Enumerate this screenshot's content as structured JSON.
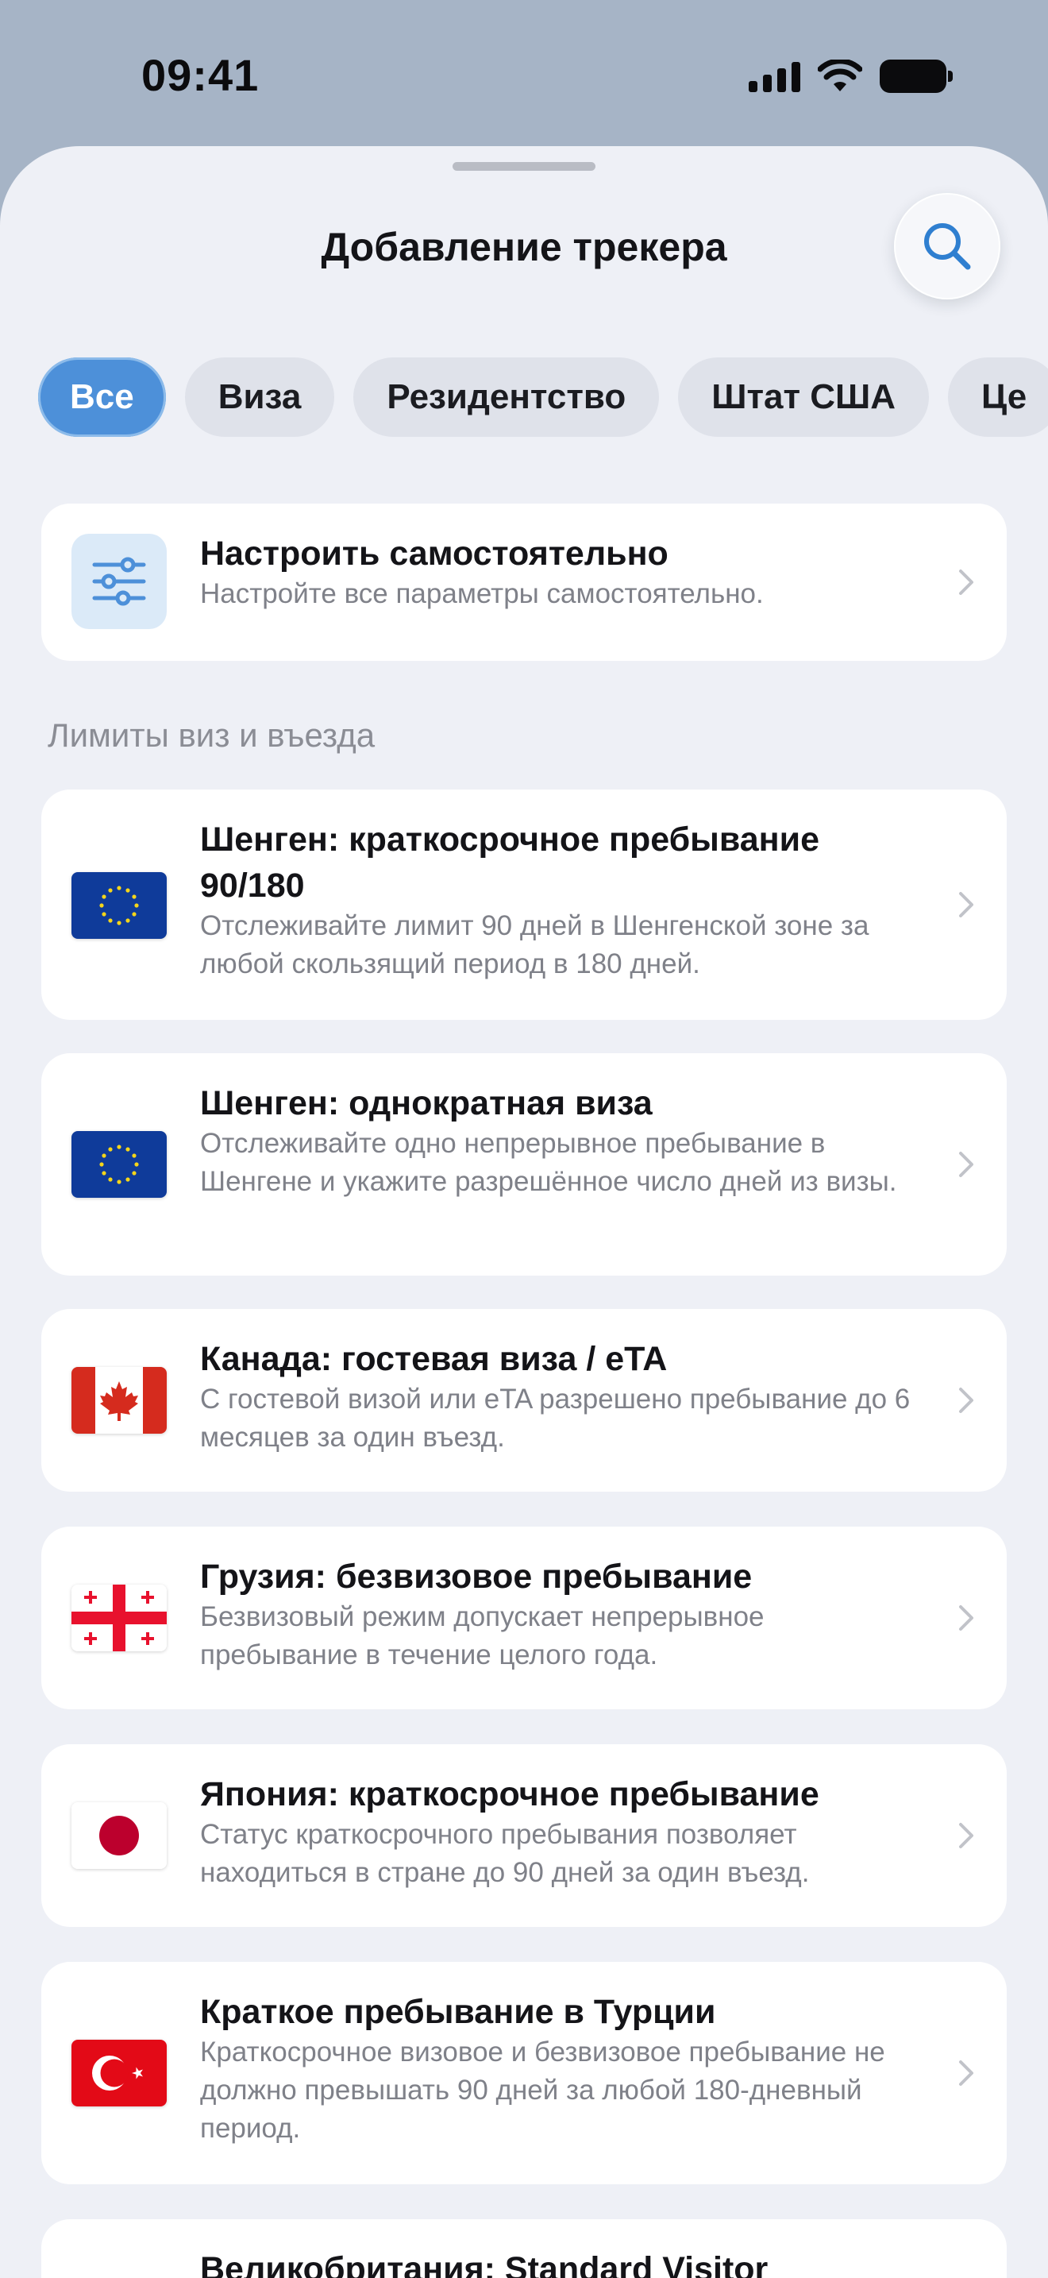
{
  "status_bar": {
    "time": "09:41"
  },
  "sheet": {
    "title": "Добавление трекера"
  },
  "filters": [
    {
      "label": "Все",
      "active": true
    },
    {
      "label": "Виза",
      "active": false
    },
    {
      "label": "Резидентство",
      "active": false
    },
    {
      "label": "Штат США",
      "active": false
    },
    {
      "label": "Це",
      "active": false
    }
  ],
  "custom": {
    "title": "Настроить самостоятельно",
    "description": "Настройте все параметры самостоятельно."
  },
  "section_title": "Лимиты виз и въезда",
  "trackers": [
    {
      "flag": "eu-flag-icon",
      "title": "Шенген: краткосрочное пребывание 90/180",
      "description": "Отслеживайте лимит 90 дней в Шенгенской зоне за любой скользящий период в 180 дней."
    },
    {
      "flag": "eu-flag-icon",
      "title": "Шенген: однократная виза",
      "description": "Отслеживайте одно непрерывное пребывание в Шенгене и укажите разрешённое число дней из визы."
    },
    {
      "flag": "canada-flag-icon",
      "title": "Канада: гостевая виза / eTA",
      "description": "С гостевой визой или eTA разрешено пребывание до 6 месяцев за один въезд."
    },
    {
      "flag": "georgia-flag-icon",
      "title": "Грузия: безвизовое пребывание",
      "description": "Безвизовый режим допускает непрерывное пребывание в течение целого года."
    },
    {
      "flag": "japan-flag-icon",
      "title": "Япония: краткосрочное пребывание",
      "description": "Статус краткосрочного пребывания позволяет находиться в стране до 90 дней за один въезд."
    },
    {
      "flag": "turkey-flag-icon",
      "title": "Краткое пребывание в Турции",
      "description": "Краткосрочное визовое и безвизовое пребыва­ние не должно превышать 90 дней за любой 180-дневный период."
    },
    {
      "flag": "uk-flag-icon",
      "title": "Великобритания: Standard Visitor",
      "description": ""
    }
  ],
  "colors": {
    "accent": "#4d90d9",
    "sheet_background": "#eef0f6",
    "backdrop": "#a6b4c6",
    "eu_blue": "#0f3b9a",
    "flag_red": "#d52b1e"
  }
}
